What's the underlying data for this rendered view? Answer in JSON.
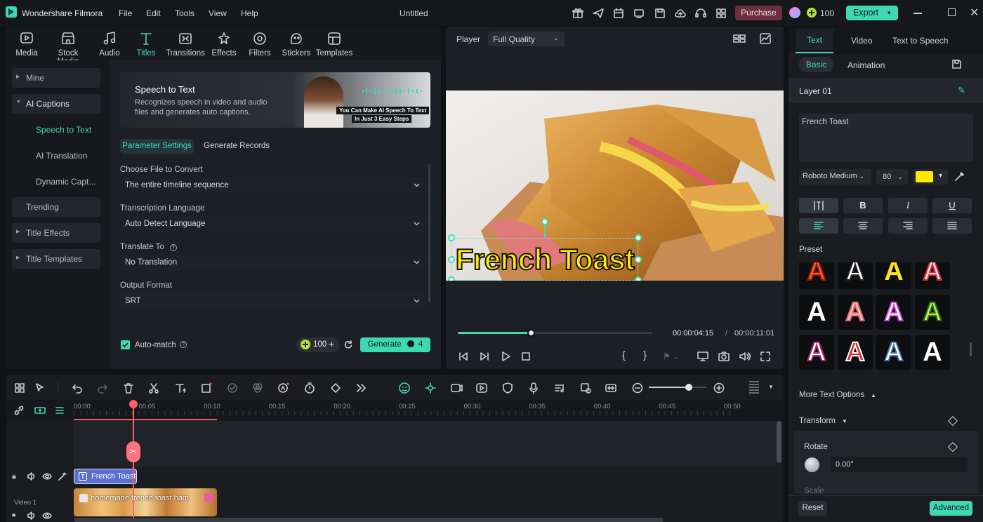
{
  "app": {
    "name": "Wondershare Filmora",
    "doc_title": "Untitled",
    "menus": [
      "File",
      "Edit",
      "Tools",
      "View",
      "Help"
    ],
    "purchase": "Purchase",
    "credits": "100",
    "export": "Export"
  },
  "tools": [
    "Media",
    "Stock Media",
    "Audio",
    "Titles",
    "Transitions",
    "Effects",
    "Filters",
    "Stickers",
    "Templates"
  ],
  "sidebar": {
    "items": [
      "Mine",
      "AI Captions",
      "Speech to Text",
      "AI Translation",
      "Dynamic Capt...",
      "Trending",
      "Title Effects",
      "Title Templates"
    ]
  },
  "banner": {
    "title": "Speech to Text",
    "desc1": "Recognizes speech in video and audio",
    "desc2": "files and generates auto captions.",
    "promo1": "You Can Make AI Speech To Text",
    "promo2": "In Just  3 Easy Steps"
  },
  "stt": {
    "tabs": [
      "Parameter Settings",
      "Generate Records"
    ],
    "file_label": "Choose File to Convert",
    "file_value": "The entire timeline sequence",
    "lang_label": "Transcription Language",
    "lang_value": "Auto Detect Language",
    "translate_label": "Translate To",
    "translate_value": "No Translation",
    "format_label": "Output Format",
    "format_value": "SRT",
    "automatch": "Auto-match",
    "credits": "100",
    "generate": "Generate",
    "generate_cost": "4"
  },
  "player": {
    "label": "Player",
    "quality": "Full Quality",
    "overlay_text": "French Toast",
    "current_time": "00:00:04:15",
    "separator": "/",
    "total_time": "00:00:11:01",
    "progress": 0.38
  },
  "right": {
    "tabs": [
      "Text",
      "Video",
      "Text to Speech"
    ],
    "subtabs": [
      "Basic",
      "Animation"
    ],
    "layer": "Layer 01",
    "text_value": "French Toast",
    "font": "Roboto Medium",
    "size": "80",
    "color": "#ffea00",
    "format_btns": [
      "B",
      "I",
      "U"
    ],
    "preset_label": "Preset",
    "more_options": "More Text Options",
    "transform": "Transform",
    "rotate": "Rotate",
    "rotate_value": "0.00°",
    "scale": "Scale",
    "reset": "Reset",
    "advanced": "Advanced"
  },
  "timeline": {
    "ruler": [
      "00:00",
      "00:05",
      "00:10",
      "00:15",
      "00:20",
      "00:25",
      "00:30",
      "00:35",
      "00:40",
      "00:45",
      "00:50"
    ],
    "title_clip": "French Toast",
    "video_clip": "homemade french toast ham",
    "track_label": "Video 1",
    "zoom": 0.7
  },
  "colors": {
    "accent": "#3dd9b3",
    "purchase": "#6b2f3d",
    "playhead": "#ff5c6c",
    "title_clip": "#5a6fd1"
  }
}
